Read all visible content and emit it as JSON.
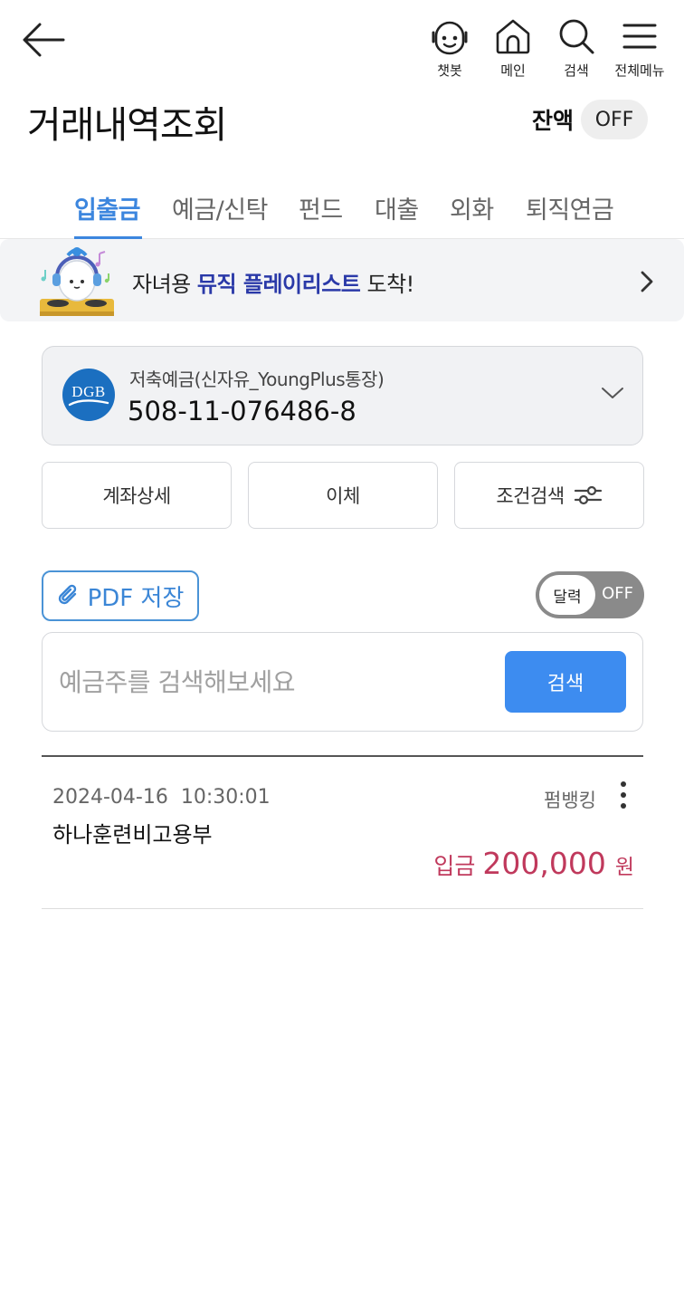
{
  "header": {
    "back_label": "back",
    "nav": [
      {
        "label": "챗봇",
        "icon": "chatbot-icon"
      },
      {
        "label": "메인",
        "icon": "home-icon"
      },
      {
        "label": "검색",
        "icon": "search-icon"
      },
      {
        "label": "전체메뉴",
        "icon": "menu-icon"
      }
    ]
  },
  "page": {
    "title": "거래내역조회",
    "balance_label": "잔액",
    "balance_toggle": "OFF"
  },
  "tabs": [
    {
      "label": "입출금",
      "active": true
    },
    {
      "label": "예금/신탁",
      "active": false
    },
    {
      "label": "펀드",
      "active": false
    },
    {
      "label": "대출",
      "active": false
    },
    {
      "label": "외화",
      "active": false
    },
    {
      "label": "퇴직연금",
      "active": false
    }
  ],
  "banner": {
    "text_prefix": "자녀용 ",
    "text_highlight": "뮤직 플레이리스트",
    "text_suffix": " 도착!"
  },
  "account": {
    "logo_text": "DGB",
    "name": "저축예금(신자유_YoungPlus통장)",
    "number": "508-11-076486-8"
  },
  "actions": {
    "detail": "계좌상세",
    "transfer": "이체",
    "filter": "조건검색"
  },
  "tools": {
    "pdf_label": "PDF 저장",
    "calendar_label": "달력",
    "calendar_state": "OFF"
  },
  "search": {
    "placeholder": "예금주를 검색해보세요",
    "button": "검색"
  },
  "transactions": [
    {
      "datetime": "2024-04-16  10:30:01",
      "channel": "펌뱅킹",
      "description": "하나훈련비고용부",
      "type": "입금",
      "amount": "200,000",
      "unit": "원"
    }
  ],
  "colors": {
    "accent": "#3c86de",
    "search_button": "#3d8cf0",
    "deposit_amount": "#c0395c",
    "banner_highlight": "#2a39a8"
  }
}
